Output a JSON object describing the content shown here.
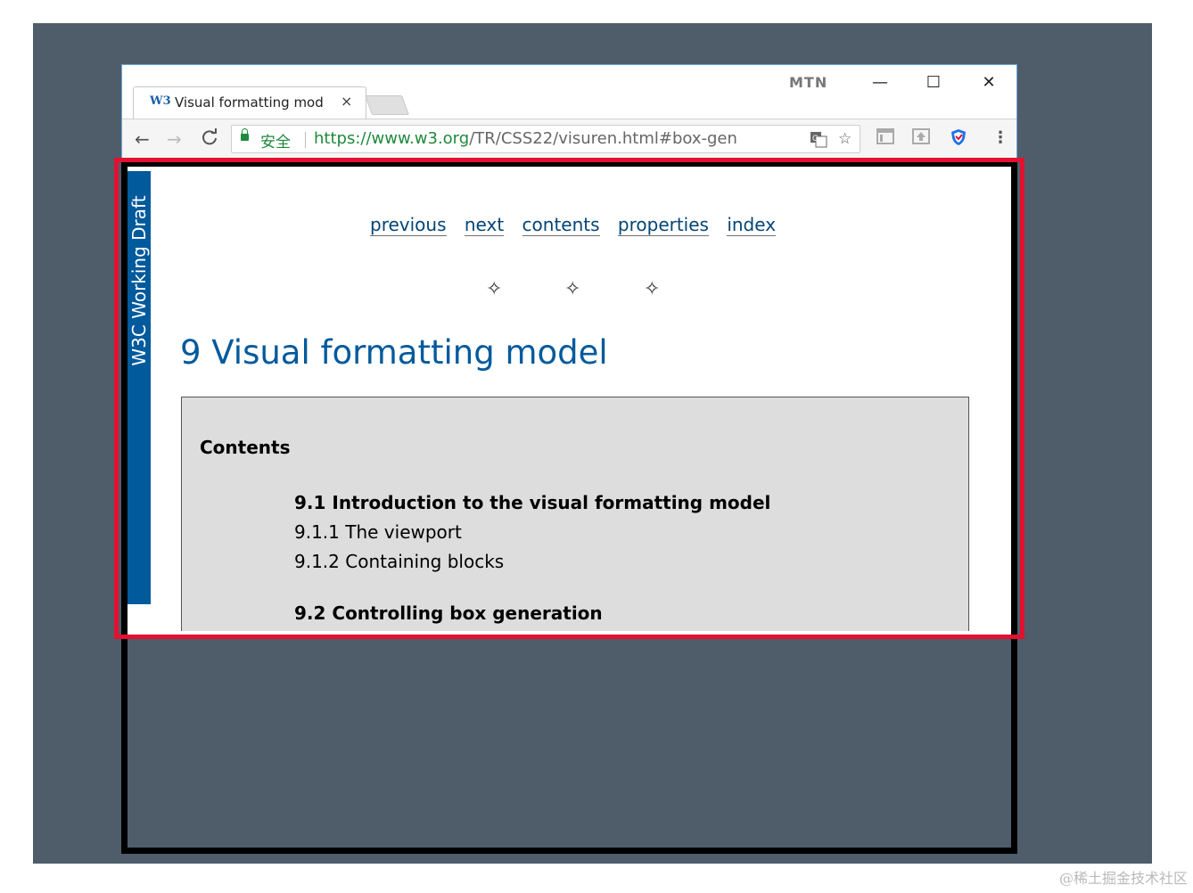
{
  "browser": {
    "tab": {
      "favicon": "W3",
      "title": "Visual formatting mod",
      "close": "×"
    },
    "profile_badge": "MTN",
    "window_controls": {
      "minimize": "—",
      "maximize": "☐",
      "close": "✕"
    },
    "toolbar": {
      "back": "←",
      "forward": "→",
      "reload": "C"
    },
    "address": {
      "secure_label": "安全",
      "url_scheme": "https://",
      "url_host": "www.w3.org",
      "url_path": "/TR/CSS22/visuren.html#box-gen"
    },
    "icons": {
      "translate": "translate-icon",
      "bookmark": "star-icon",
      "reader": "reader-icon",
      "extension": "extension-icon",
      "shield": "shield-icon",
      "menu": "menu-icon"
    }
  },
  "page": {
    "sidebar_label": "W3C Working Draft",
    "nav": [
      "previous",
      "next",
      "contents",
      "properties",
      "index"
    ],
    "title": "9 Visual formatting model",
    "contents": {
      "heading": "Contents",
      "items": [
        {
          "text": "9.1 Introduction to the visual formatting model",
          "bold": true
        },
        {
          "text": "9.1.1 The viewport",
          "bold": false
        },
        {
          "text": "9.1.2 Containing blocks",
          "bold": false
        },
        {
          "text": "9.2 Controlling box generation",
          "bold": true
        }
      ]
    }
  },
  "watermark": "@稀土掘金技术社区",
  "colors": {
    "highlight_frame": "#e3102f",
    "w3c_blue": "#005a9c",
    "backdrop": "#4f5d6b"
  }
}
